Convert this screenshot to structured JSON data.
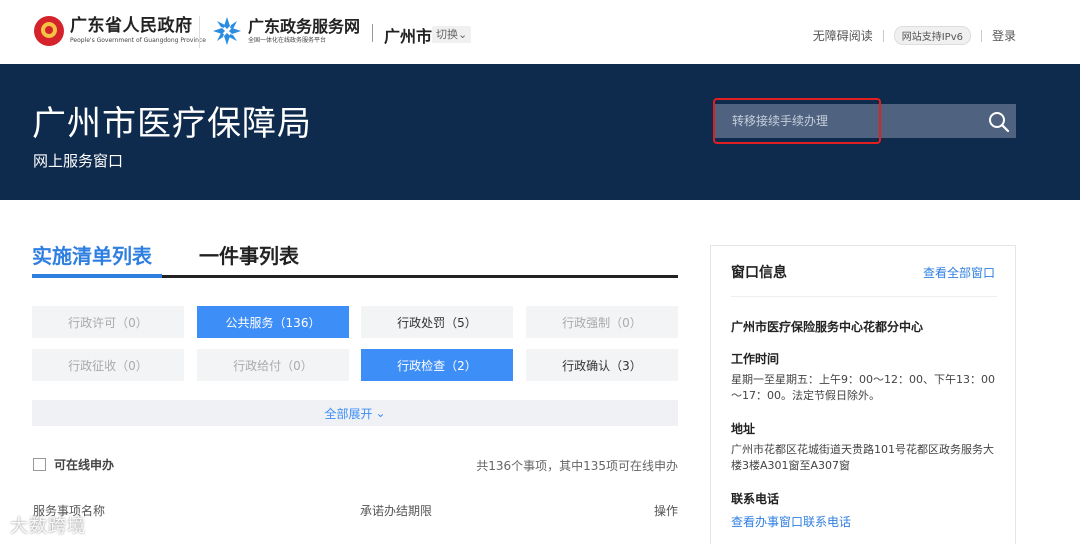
{
  "header": {
    "gov_name": "广东省人民政府",
    "gov_name_en": "People's Government of Guangdong Province",
    "portal_name": "广东政务服务网",
    "portal_slogan": "全国一体化在线政务服务平台",
    "city": "广州市",
    "switch_label": "切换",
    "accessibility": "无障碍阅读",
    "ipv6": "网站支持IPv6",
    "login": "登录"
  },
  "banner": {
    "title": "广州市医疗保障局",
    "subtitle": "网上服务窗口",
    "search_placeholder": "转移接续手续办理"
  },
  "tabs": [
    {
      "label": "实施清单列表",
      "active": true
    },
    {
      "label": "一件事列表",
      "active": false
    }
  ],
  "categories": [
    {
      "label": "行政许可（0）",
      "state": "disabled"
    },
    {
      "label": "公共服务（136）",
      "state": "active"
    },
    {
      "label": "行政处罚（5）",
      "state": "normal"
    },
    {
      "label": "行政强制（0）",
      "state": "disabled"
    },
    {
      "label": "行政征收（0）",
      "state": "disabled"
    },
    {
      "label": "行政给付（0）",
      "state": "disabled"
    },
    {
      "label": "行政检查（2）",
      "state": "active"
    },
    {
      "label": "行政确认（3）",
      "state": "normal"
    }
  ],
  "expand_label": "全部展开",
  "filter": {
    "online_label": "可在线申办",
    "count_text": "共136个事项，其中135项可在线申办"
  },
  "table_headers": [
    "服务事项名称",
    "承诺办结期限",
    "操作"
  ],
  "watermark": "大数跨境",
  "window_info": {
    "title": "窗口信息",
    "view_all": "查看全部窗口",
    "center_name": "广州市医疗保险服务中心花都分中心",
    "hours_title": "工作时间",
    "hours_text": "星期一至星期五：上午9：00～12：00、下午13：00～17：00。法定节假日除外。",
    "address_title": "地址",
    "address_text": "广州市花都区花城街道天贵路101号花都区政务服务大楼3楼A301窗至A307窗",
    "phone_title": "联系电话",
    "phone_link": "查看办事窗口联系电话"
  },
  "colors": {
    "banner_bg": "#0e2a4d",
    "accent": "#3e8ef7",
    "highlight": "#e02020"
  }
}
